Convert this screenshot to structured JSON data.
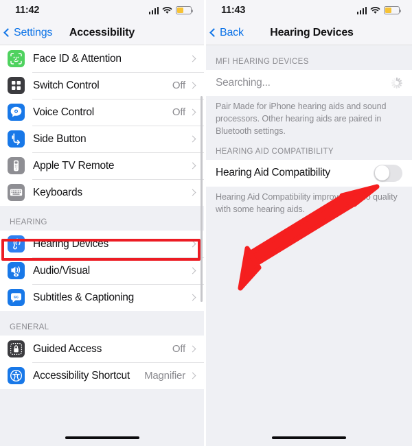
{
  "meta": {
    "accent_blue": "#0b72e7",
    "highlight_red": "#ec1c24",
    "arrow_red": "#f51f1f",
    "background": "#eff0f4"
  },
  "left_panel": {
    "status_bar": {
      "time": "11:42",
      "signal_icon": "cellular-signal-icon",
      "wifi_icon": "wifi-icon",
      "battery_icon": "battery-low-power-icon"
    },
    "nav": {
      "back_label": "Settings",
      "back_icon": "chevron-left-icon",
      "title": "Accessibility"
    },
    "groups": [
      {
        "header": "",
        "rows": [
          {
            "label": "Face ID & Attention",
            "value": "",
            "icon": "face-id-icon",
            "icon_bg": "#4fd25f"
          },
          {
            "label": "Switch Control",
            "value": "Off",
            "icon": "switch-control-icon",
            "icon_bg": "#3b3b3f"
          },
          {
            "label": "Voice Control",
            "value": "Off",
            "icon": "voice-control-icon",
            "icon_bg": "#1878e8"
          },
          {
            "label": "Side Button",
            "value": "",
            "icon": "side-button-icon",
            "icon_bg": "#1878e8"
          },
          {
            "label": "Apple TV Remote",
            "value": "",
            "icon": "apple-tv-remote-icon",
            "icon_bg": "#8e8e93"
          },
          {
            "label": "Keyboards",
            "value": "",
            "icon": "keyboard-icon",
            "icon_bg": "#8e8e93"
          }
        ]
      },
      {
        "header": "HEARING",
        "rows": [
          {
            "label": "Hearing Devices",
            "value": "",
            "icon": "hearing-devices-ear-icon",
            "icon_bg": "#2d7ff0"
          },
          {
            "label": "Audio/Visual",
            "value": "",
            "icon": "audio-visual-icon",
            "icon_bg": "#1878e8"
          },
          {
            "label": "Subtitles & Captioning",
            "value": "",
            "icon": "subtitles-captioning-icon",
            "icon_bg": "#1878e8"
          }
        ]
      },
      {
        "header": "GENERAL",
        "rows": [
          {
            "label": "Guided Access",
            "value": "Off",
            "icon": "guided-access-lock-icon",
            "icon_bg": "#3b3b3f"
          },
          {
            "label": "Accessibility Shortcut",
            "value": "Magnifier",
            "icon": "accessibility-person-icon",
            "icon_bg": "#1878e8"
          }
        ]
      }
    ],
    "highlight": {
      "target_label": "Hearing Devices"
    }
  },
  "right_panel": {
    "status_bar": {
      "time": "11:43",
      "signal_icon": "cellular-signal-icon",
      "wifi_icon": "wifi-icon",
      "battery_icon": "battery-low-power-icon"
    },
    "nav": {
      "back_label": "Back",
      "back_icon": "chevron-left-icon",
      "title": "Hearing Devices"
    },
    "mfi_section": {
      "header": "MFI HEARING DEVICES",
      "searching_label": "Searching...",
      "spinner_icon": "activity-spinner-icon",
      "footnote": "Pair Made for iPhone hearing aids and sound processors. Other hearing aids are paired in Bluetooth settings."
    },
    "compat_section": {
      "header": "HEARING AID COMPATIBILITY",
      "toggle_label": "Hearing Aid Compatibility",
      "toggle_state": "off",
      "footnote": "Hearing Aid Compatibility improves audio quality with some hearing aids."
    },
    "annotation": {
      "arrow_icon": "red-pointer-arrow-icon"
    }
  }
}
